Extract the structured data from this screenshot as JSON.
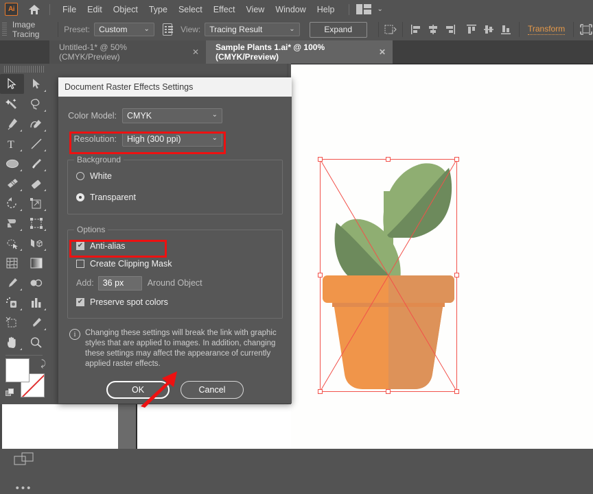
{
  "app": {
    "logo_text": "Ai",
    "home_icon": "home-icon",
    "menus": [
      "File",
      "Edit",
      "Object",
      "Type",
      "Select",
      "Effect",
      "View",
      "Window",
      "Help"
    ],
    "workspace_switcher_icon": "workspace-icon",
    "workspace_chevron": "⌄"
  },
  "control_bar": {
    "title": "Image Tracing",
    "preset_label": "Preset:",
    "preset_value": "Custom",
    "preset_chevron": "⌄",
    "panel_icon": "tracing-panel-icon",
    "view_label": "View:",
    "view_value": "Tracing Result",
    "view_chevron": "⌄",
    "expand_label": "Expand",
    "artboard_icon": "artboard-icon",
    "align_icons": [
      "align-left-icon",
      "align-horizontal-center-icon",
      "align-right-icon",
      "align-top-icon",
      "align-vertical-center-icon",
      "align-bottom-icon"
    ],
    "transform_label": "Transform",
    "isolate_icon": "isolate-selection-icon"
  },
  "tabs": [
    {
      "title": "Untitled-1* @ 50% (CMYK/Preview)",
      "close": "✕",
      "active": false
    },
    {
      "title": "Sample Plants 1.ai* @ 100% (CMYK/Preview)",
      "close": "✕",
      "active": true
    }
  ],
  "tools": [
    {
      "name": "selection-tool",
      "selected": true
    },
    {
      "name": "direct-selection-tool",
      "selected": false
    },
    {
      "name": "magic-wand-tool",
      "selected": false
    },
    {
      "name": "lasso-tool",
      "selected": false
    },
    {
      "name": "pen-tool",
      "selected": false
    },
    {
      "name": "curvature-tool",
      "selected": false
    },
    {
      "name": "type-tool",
      "selected": false
    },
    {
      "name": "line-segment-tool",
      "selected": false
    },
    {
      "name": "ellipse-tool",
      "selected": false
    },
    {
      "name": "paintbrush-tool",
      "selected": false
    },
    {
      "name": "shaper-tool",
      "selected": false
    },
    {
      "name": "eraser-tool",
      "selected": false
    },
    {
      "name": "rotate-tool",
      "selected": false
    },
    {
      "name": "scale-tool",
      "selected": false
    },
    {
      "name": "width-tool",
      "selected": false
    },
    {
      "name": "free-transform-tool",
      "selected": false
    },
    {
      "name": "shape-builder-tool",
      "selected": false
    },
    {
      "name": "perspective-grid-tool",
      "selected": false
    },
    {
      "name": "mesh-tool",
      "selected": false
    },
    {
      "name": "gradient-tool",
      "selected": false
    },
    {
      "name": "eyedropper-tool",
      "selected": false
    },
    {
      "name": "blend-tool",
      "selected": false
    },
    {
      "name": "symbol-sprayer-tool",
      "selected": false
    },
    {
      "name": "column-graph-tool",
      "selected": false
    },
    {
      "name": "artboard-tool",
      "selected": false
    },
    {
      "name": "slice-tool",
      "selected": false
    },
    {
      "name": "hand-tool",
      "selected": false
    },
    {
      "name": "zoom-tool",
      "selected": false
    }
  ],
  "tool_panel": {
    "fill_color": "#ffffff",
    "stroke_color": "none",
    "color_modes": [
      "color-swatch-mode",
      "gradient-mode",
      "none-mode"
    ],
    "screen_modes": [
      "draw-normal-mode",
      "draw-behind-mode",
      "draw-inside-mode"
    ],
    "more_tools": "•••"
  },
  "dialog": {
    "title": "Document Raster Effects Settings",
    "color_model_label": "Color Model:",
    "color_model_value": "CMYK",
    "resolution_label": "Resolution:",
    "resolution_value": "High (300 ppi)",
    "chevron": "⌄",
    "background": {
      "legend": "Background",
      "options": [
        {
          "label": "White",
          "selected": false
        },
        {
          "label": "Transparent",
          "selected": true
        }
      ]
    },
    "options": {
      "legend": "Options",
      "anti_alias": {
        "label": "Anti-alias",
        "checked": true,
        "mark": "✔"
      },
      "clipping_mask": {
        "label": "Create Clipping Mask",
        "checked": false,
        "mark": ""
      },
      "add_label": "Add:",
      "add_value": "36 px",
      "add_suffix": "Around Object",
      "preserve_spot": {
        "label": "Preserve spot colors",
        "checked": true,
        "mark": "✔"
      }
    },
    "note_icon": "info-icon",
    "note_text": "Changing these settings will break the link with graphic styles that are applied to images. In addition, changing these settings may affect the appearance of currently applied raster effects.",
    "ok_label": "OK",
    "cancel_label": "Cancel"
  },
  "annotations": {
    "highlight_color": "#ee1111",
    "arrow_icon": "red-arrow-pointer",
    "boxes": [
      "resolution-highlight",
      "anti-alias-highlight"
    ]
  },
  "artwork": {
    "name": "potted-plant-illustration",
    "leaf_light": "#8fae72",
    "leaf_dark": "#6d8a5c",
    "pot_light": "#f0954a",
    "pot_dark": "#dd9259",
    "selection_color": "#f2514a"
  }
}
